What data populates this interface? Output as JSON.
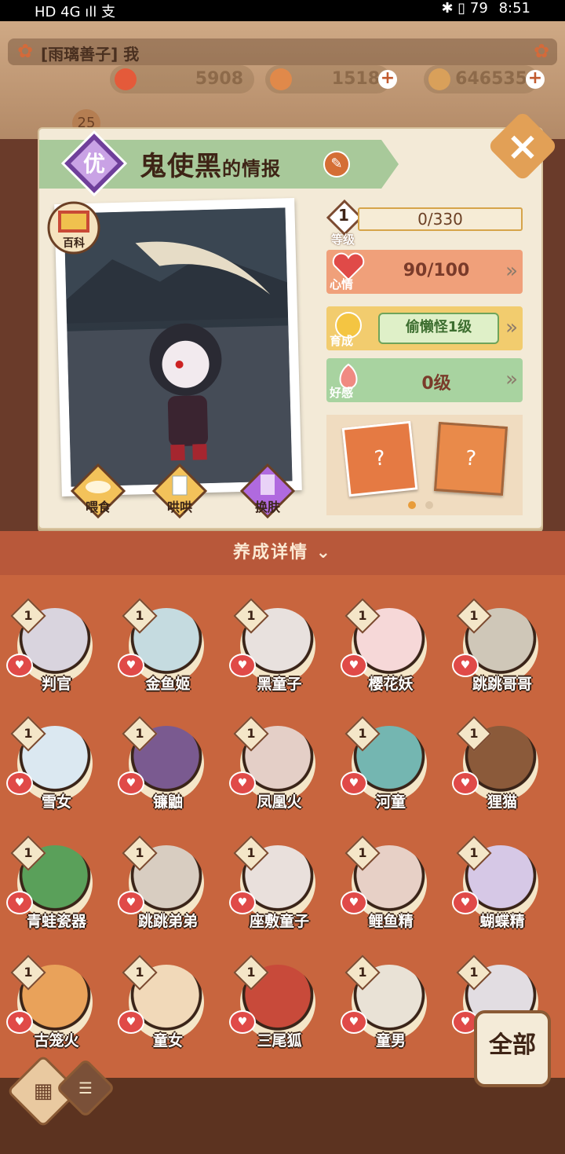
{
  "status_bar": {
    "left": "HD 4G ıll 支",
    "right_icons": "✱ ▯ 79",
    "time": "8:51"
  },
  "hud": {
    "player_name": "[雨璃善子] 我",
    "level": "25",
    "resources": [
      {
        "value": "5908",
        "icon": "gem-icon",
        "color": "#e45a3a"
      },
      {
        "value": "1518",
        "icon": "food-icon",
        "color": "#e0894a"
      },
      {
        "value": "646535",
        "icon": "coin-icon",
        "color": "#d9a05a"
      }
    ]
  },
  "info": {
    "grade": "优",
    "title_name": "鬼使黑",
    "title_suffix": "的情报",
    "encyclopedia": "百科",
    "actions": [
      {
        "label": "喂食",
        "icon": "bowl-icon"
      },
      {
        "label": "哄哄",
        "icon": "milk-icon"
      },
      {
        "label": "换肤",
        "icon": "outfit-icon"
      }
    ],
    "stats": {
      "level_label": "等级",
      "level_value": "1",
      "level_progress": "0/330",
      "mood_label": "心情",
      "mood_value": "90/100",
      "grow_label": "育成",
      "grow_value": "偷懒怪1级",
      "affinity_label": "好感",
      "affinity_value": "0级"
    }
  },
  "detail_bar": {
    "label": "养成详情"
  },
  "characters": [
    {
      "name": "判官",
      "level": "1",
      "color": "#d9d4de"
    },
    {
      "name": "金鱼姬",
      "level": "1",
      "color": "#c5dbe0"
    },
    {
      "name": "黑童子",
      "level": "1",
      "color": "#e8e1de"
    },
    {
      "name": "樱花妖",
      "level": "1",
      "color": "#f6d8d8"
    },
    {
      "name": "跳跳哥哥",
      "level": "1",
      "color": "#cfc7b8"
    },
    {
      "name": "雪女",
      "level": "1",
      "color": "#dbe8f1"
    },
    {
      "name": "镰鼬",
      "level": "1",
      "color": "#7a5a90"
    },
    {
      "name": "凤凰火",
      "level": "1",
      "color": "#e4cfc7"
    },
    {
      "name": "河童",
      "level": "1",
      "color": "#74b6b1"
    },
    {
      "name": "狸猫",
      "level": "1",
      "color": "#8b5a3a"
    },
    {
      "name": "青蛙瓷器",
      "level": "1",
      "color": "#5aa05a"
    },
    {
      "name": "跳跳弟弟",
      "level": "1",
      "color": "#d8cdc1"
    },
    {
      "name": "座敷童子",
      "level": "1",
      "color": "#e9e0dc"
    },
    {
      "name": "鲤鱼精",
      "level": "1",
      "color": "#e7d0c6"
    },
    {
      "name": "蝴蝶精",
      "level": "1",
      "color": "#d6c8e6"
    },
    {
      "name": "古笼火",
      "level": "1",
      "color": "#e9a25a"
    },
    {
      "name": "童女",
      "level": "1",
      "color": "#f1d9b9"
    },
    {
      "name": "三尾狐",
      "level": "1",
      "color": "#c84a3a"
    },
    {
      "name": "童男",
      "level": "1",
      "color": "#e9e2d6"
    },
    {
      "name": "",
      "level": "1",
      "color": "#e2dde2"
    }
  ],
  "controls": {
    "all_label": "全部"
  }
}
